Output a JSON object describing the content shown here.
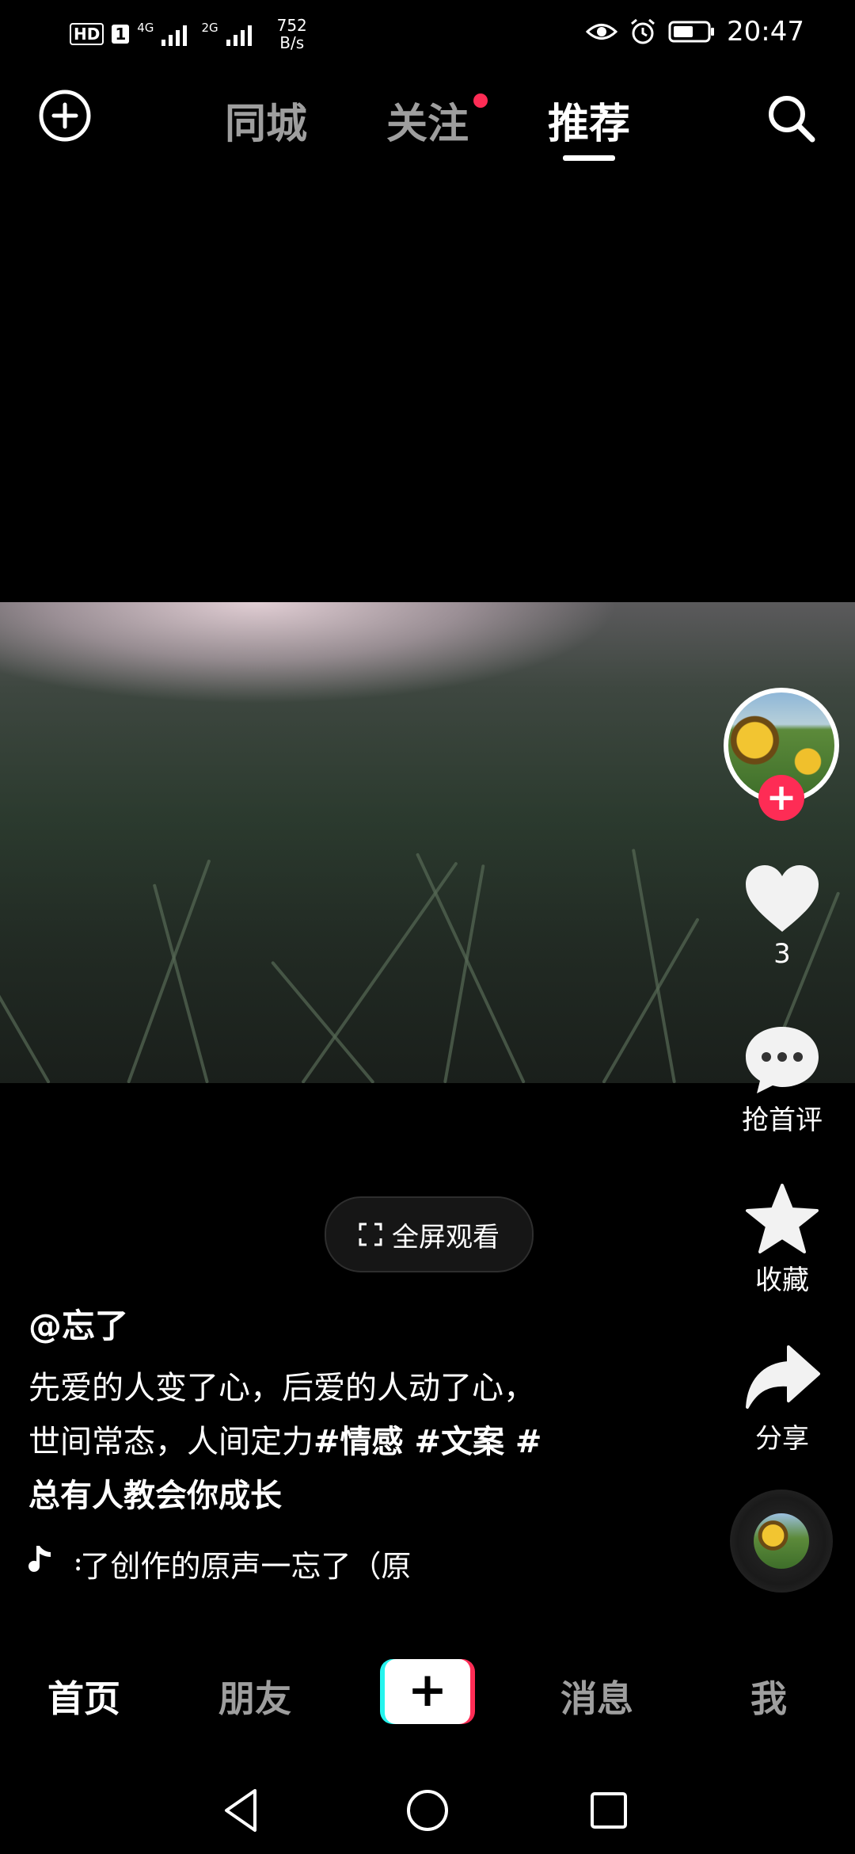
{
  "status_bar": {
    "hd": "HD",
    "sim": "1",
    "net1": "4G",
    "net2": "2G",
    "speed_value": "752",
    "speed_unit": "B/s",
    "time": "20:47"
  },
  "top_nav": {
    "tabs": [
      {
        "label": "同城"
      },
      {
        "label": "关注"
      },
      {
        "label": "推荐"
      }
    ]
  },
  "video": {
    "likes": "3",
    "comment_label": "抢首评",
    "favorite_label": "收藏",
    "share_label": "分享",
    "fullscreen_label": "全屏观看"
  },
  "post": {
    "username": "@忘了",
    "caption_line1": "先爱的人变了心，后爱的人动了心，",
    "caption_line2_text": "世间常态，人间定力",
    "caption_line2_tags": "#情感 #文案 #",
    "caption_line3_tag": "总有人教会你成长",
    "music": "ₑ了创作的原声一忘了（原",
    "music_display": "᠄了创作的原声一忘了（原"
  },
  "bottom_nav": {
    "items": [
      {
        "label": "首页"
      },
      {
        "label": "朋友"
      },
      {
        "label": "消息"
      },
      {
        "label": "我"
      }
    ]
  },
  "colors": {
    "accent": "#fe2c55",
    "cyan": "#25f4ee",
    "background": "#000000"
  },
  "icons": [
    "add-circle-icon",
    "search-icon",
    "heart-icon",
    "comment-icon",
    "star-icon",
    "share-icon",
    "music-note-icon",
    "fullscreen-icon",
    "back-icon",
    "home-icon",
    "recents-icon",
    "eye-icon",
    "alarm-icon",
    "battery-icon",
    "signal-icon"
  ]
}
